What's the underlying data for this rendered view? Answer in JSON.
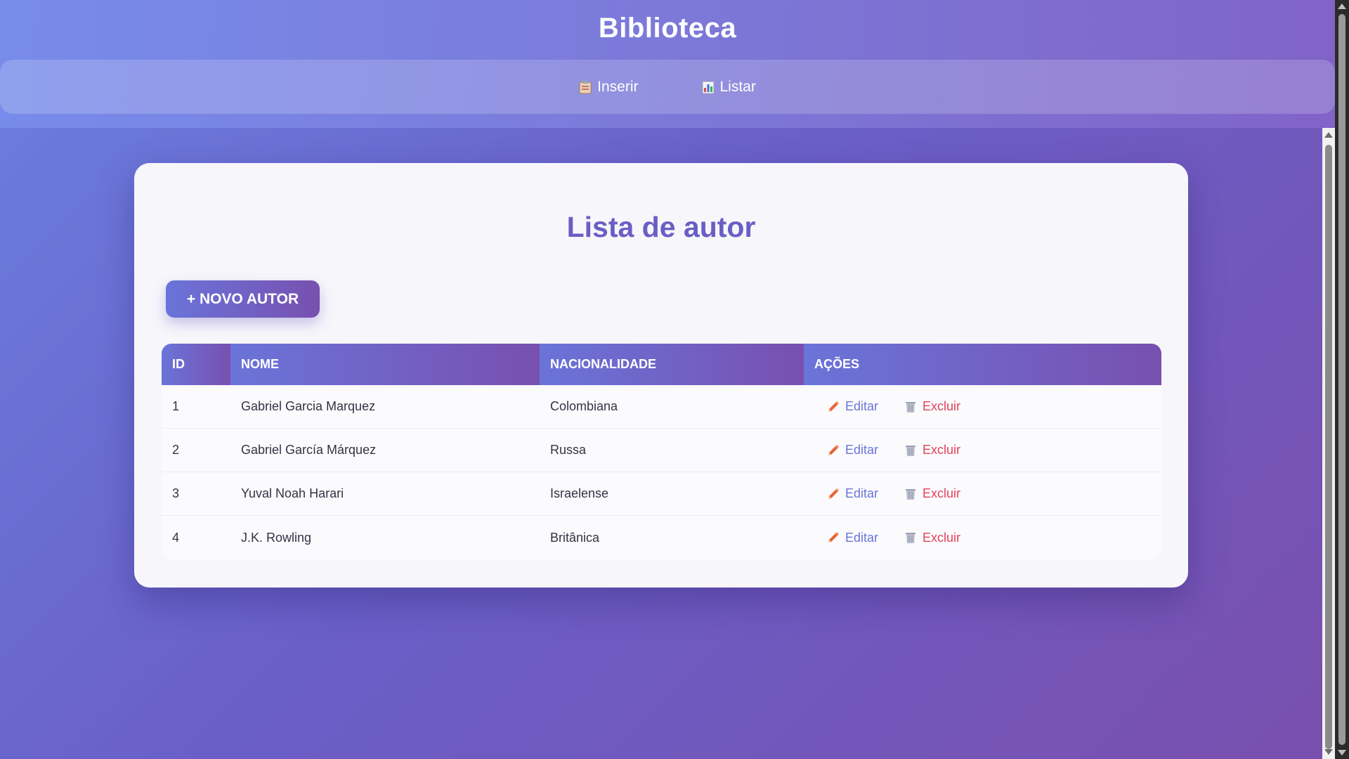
{
  "header": {
    "title": "Biblioteca",
    "nav": [
      {
        "label": "Inserir",
        "icon": "clipboard-icon"
      },
      {
        "label": "Listar",
        "icon": "bar-chart-icon"
      }
    ]
  },
  "main": {
    "title": "Lista de autor",
    "new_button_label": "+ NOVO AUTOR",
    "table": {
      "columns": [
        "ID",
        "NOME",
        "NACIONALIDADE",
        "AÇÕES"
      ],
      "rows": [
        {
          "id": "1",
          "nome": "Gabriel Garcia Marquez",
          "nacionalidade": "Colombiana"
        },
        {
          "id": "2",
          "nome": "Gabriel García Márquez",
          "nacionalidade": "Russa"
        },
        {
          "id": "3",
          "nome": "Yuval Noah Harari",
          "nacionalidade": "Israelense"
        },
        {
          "id": "4",
          "nome": "J.K. Rowling",
          "nacionalidade": "Britânica"
        }
      ],
      "actions": {
        "edit_label": "Editar",
        "delete_label": "Excluir"
      }
    }
  },
  "colors": {
    "accent": "#6a5ec4",
    "gradient_start": "#6a74d9",
    "gradient_end": "#7850b0",
    "edit": "#6a74d9",
    "delete": "#e4405a"
  }
}
